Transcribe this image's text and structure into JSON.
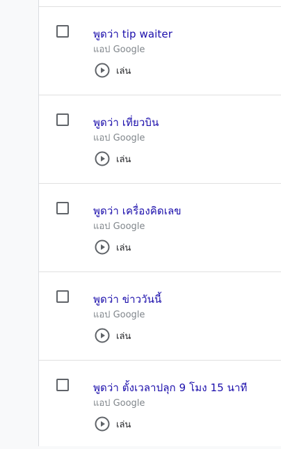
{
  "items": [
    {
      "title": "พูดว่า tip waiter",
      "source": "แอป Google",
      "play_label": "เล่น"
    },
    {
      "title": "พูดว่า เที่ยวบิน",
      "source": "แอป Google",
      "play_label": "เล่น"
    },
    {
      "title": "พูดว่า เครื่องคิดเลข",
      "source": "แอป Google",
      "play_label": "เล่น"
    },
    {
      "title": "พูดว่า ข่าววันนี้",
      "source": "แอป Google",
      "play_label": "เล่น"
    },
    {
      "title": "พูดว่า ตั้งเวลาปลุก 9 โมง 15 นาที",
      "source": "แอป Google",
      "play_label": "เล่น"
    }
  ],
  "colors": {
    "title": "#1a0dab",
    "subtitle": "#80868b",
    "icon": "#5f6368",
    "divider": "#e0e0e0"
  },
  "icons": {
    "checkbox": "checkbox-icon",
    "play": "play-circle-icon"
  }
}
